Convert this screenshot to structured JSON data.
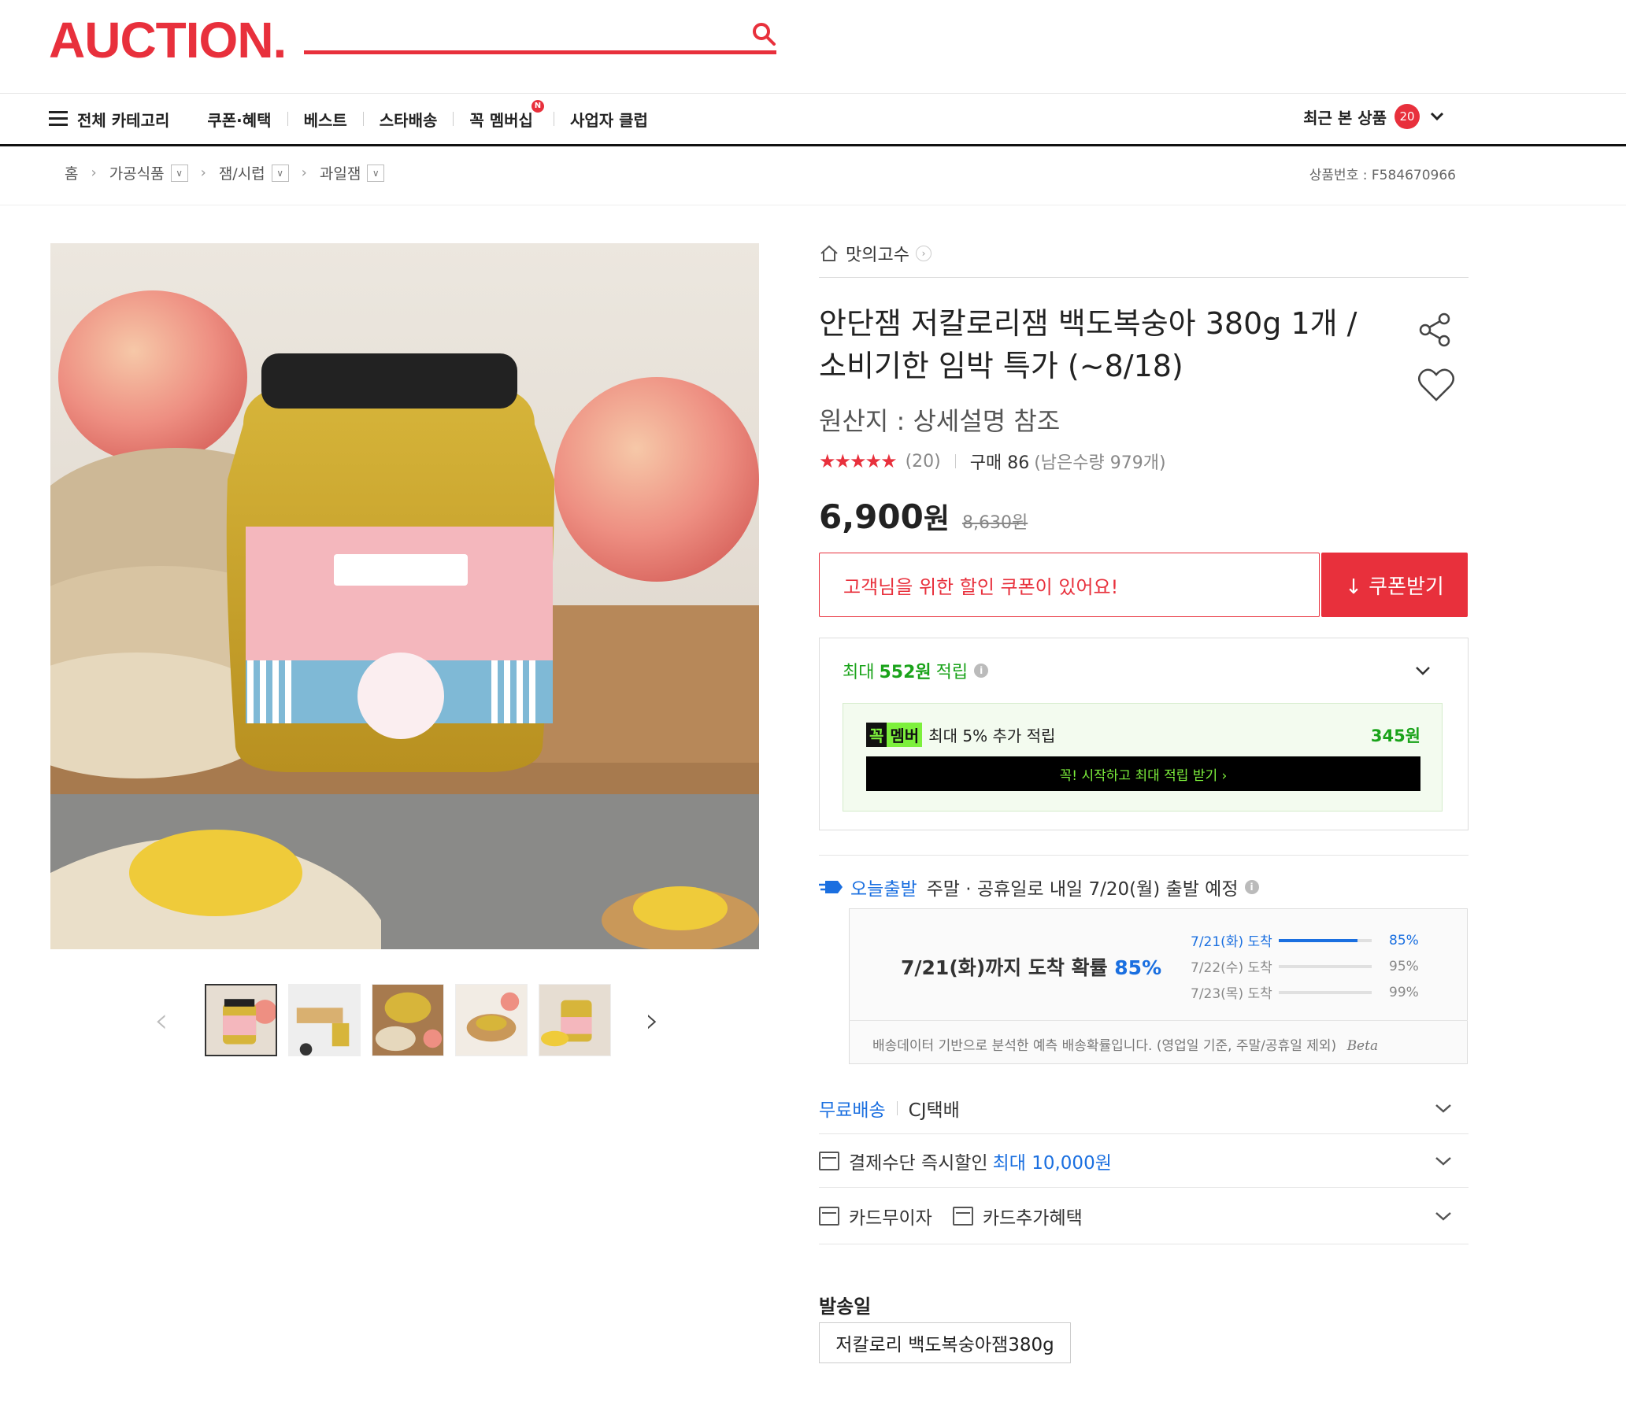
{
  "header": {
    "logo": "AUCTION.",
    "nav": [
      "전체 카테고리",
      "쿠폰·혜택",
      "베스트",
      "스타배송",
      "꼭 멤버십",
      "사업자 클럽"
    ],
    "nav_badge": "N",
    "recent_label": "최근 본 상품",
    "recent_count": "20"
  },
  "breadcrumb": {
    "home": "홈",
    "items": [
      "가공식품",
      "잼/시럽",
      "과일잼"
    ],
    "product_no": "상품번호 : F584670966"
  },
  "product": {
    "seller": "맛의고수",
    "title_line1": "안단잼 저칼로리잼 백도복숭아 380g 1개 /",
    "title_line2": "소비기한 임박 특가 (~8/18)",
    "origin": "원산지 : 상세설명 참조",
    "stars": "★★★★★",
    "review_count": "(20)",
    "purchase_label": "구매 86",
    "remain": "(남은수량 979개)",
    "price": "6,900",
    "price_unit": "원",
    "orig_price": "8,630원",
    "rating": 4.5
  },
  "coupon": {
    "message": "고객님을 위한 할인 쿠폰이 있어요!",
    "button": "↓ 쿠폰받기"
  },
  "points": {
    "prefix": "최대 ",
    "amount": "552원",
    "suffix": " 적립",
    "member_k": "꼭",
    "member_m": "멤버",
    "member_text": "최대 5% 추가 적립",
    "member_amount": "345원",
    "member_button": "꼭! 시작하고 최대 적립 받기 ›"
  },
  "shipping": {
    "today_label": "오늘출발",
    "today_text": "주말 · 공휴일로 내일 7/20(월) 출발 예정",
    "prob_main": "7/21(화)까지 도착 확률 ",
    "prob_pct": "85%",
    "lines": [
      {
        "label": "7/21(화) 도착",
        "value": "85%",
        "fill": 0.85
      },
      {
        "label": "7/22(수) 도착",
        "value": "95%",
        "fill": 0
      },
      {
        "label": "7/23(목) 도착",
        "value": "99%",
        "fill": 0
      }
    ],
    "note": "배송데이터 기반으로 분석한 예측 배송확률입니다. (영업일 기준, 주말/공휴일 제외)",
    "beta": "Beta",
    "free_ship": "무료배송",
    "courier": "CJ택배",
    "payment_label": "결제수단 즉시할인 ",
    "payment_amount": "최대 10,000원",
    "card_free": "카드무이자",
    "card_benefit": "카드추가혜택"
  },
  "ship_date": {
    "label": "발송일",
    "option": "저칼로리 백도복숭아잼380g"
  },
  "colors": {
    "brand": "#e8303c",
    "green": "#1aa31a",
    "blue": "#1a6fe0",
    "member_green": "#7df03c"
  }
}
